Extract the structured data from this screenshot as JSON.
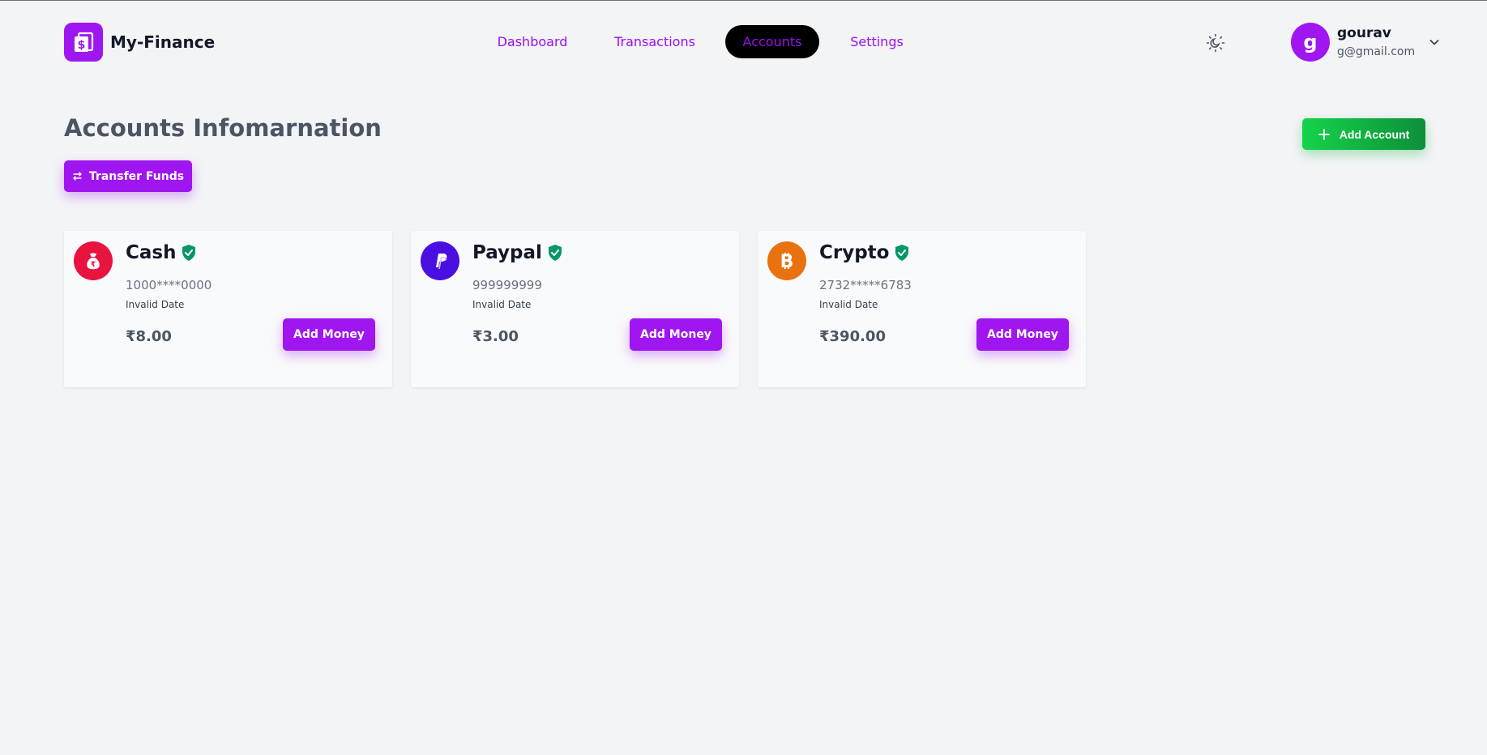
{
  "app": {
    "name": "My-Finance"
  },
  "nav": {
    "items": [
      {
        "label": "Dashboard"
      },
      {
        "label": "Transactions"
      },
      {
        "label": "Accounts"
      },
      {
        "label": "Settings"
      }
    ],
    "active": "Accounts"
  },
  "user": {
    "initial": "g",
    "name": "gourav",
    "email": "g@gmail.com"
  },
  "page": {
    "title": "Accounts Infomarnation",
    "transfer_label": "Transfer Funds",
    "add_account_label": "Add Account"
  },
  "accounts": [
    {
      "name": "Cash",
      "number": "1000****0000",
      "date": "Invalid Date",
      "balance": "₹8.00",
      "button": "Add Money",
      "icon": "cash-icon"
    },
    {
      "name": "Paypal",
      "number": "999999999",
      "date": "Invalid Date",
      "balance": "₹3.00",
      "button": "Add Money",
      "icon": "paypal-icon"
    },
    {
      "name": "Crypto",
      "number": "2732*****6783",
      "date": "Invalid Date",
      "balance": "₹390.00",
      "button": "Add Money",
      "icon": "bitcoin-icon"
    }
  ],
  "colors": {
    "brand": "#a016f0",
    "success": "#16b34a",
    "verified": "#059669",
    "cash_icon_bg": "#e8133f",
    "paypal_icon_bg": "#4a0fe0",
    "crypto_icon_bg": "#e8720f"
  }
}
